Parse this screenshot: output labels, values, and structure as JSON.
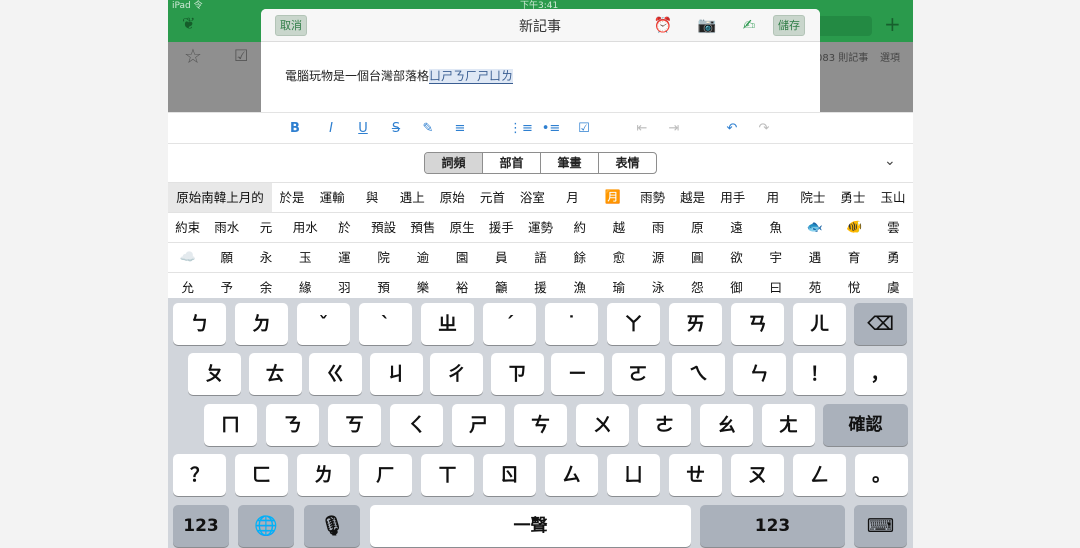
{
  "status_bar": {
    "carrier": "iPad 令",
    "time": "下午3:41"
  },
  "app_bg": {
    "count_label": "083 則記事",
    "options_label": "選項"
  },
  "editor": {
    "cancel_label": "取消",
    "title": "新記事",
    "save_label": "儲存",
    "note_text": "電腦玩物是一個台灣部落格",
    "composing_text": "ㄩㄕㄋㄏㄕㄩㄌ"
  },
  "toolbar": {
    "icons": [
      "bold-icon",
      "italic-icon",
      "underline-icon",
      "strikethrough-icon",
      "highlight-icon",
      "align-icon",
      "numbered-list-icon",
      "bullet-list-icon",
      "checkbox-icon",
      "outdent-icon",
      "indent-icon",
      "undo-icon",
      "redo-icon"
    ],
    "glyphs": [
      "B",
      "I",
      "U",
      "S",
      "✎",
      "≡",
      "⋮≡",
      "•≡",
      "☑",
      "⇤",
      "⇥",
      "↶",
      "↷"
    ]
  },
  "candidate_tabs": [
    {
      "label": "詞頻",
      "active": true
    },
    {
      "label": "部首",
      "active": false
    },
    {
      "label": "筆畫",
      "active": false
    },
    {
      "label": "表情",
      "active": false
    }
  ],
  "candidate_rows": [
    [
      "原始南韓上月的",
      "於是",
      "運輸",
      "與",
      "遇上",
      "原始",
      "元首",
      "浴室",
      "月",
      "🈷️",
      "雨勢",
      "越是",
      "用手",
      "用",
      "院士",
      "勇士",
      "玉山"
    ],
    [
      "約束",
      "雨水",
      "元",
      "用水",
      "於",
      "預設",
      "預售",
      "原生",
      "援手",
      "運勢",
      "約",
      "越",
      "雨",
      "原",
      "遠",
      "魚",
      "🐟",
      "🐠",
      "雲"
    ],
    [
      "☁️",
      "願",
      "永",
      "玉",
      "運",
      "院",
      "逾",
      "園",
      "員",
      "語",
      "餘",
      "愈",
      "源",
      "圓",
      "欲",
      "宇",
      "遇",
      "育",
      "勇"
    ],
    [
      "允",
      "予",
      "余",
      "緣",
      "羽",
      "預",
      "樂",
      "裕",
      "籲",
      "援",
      "漁",
      "瑜",
      "泳",
      "怨",
      "御",
      "曰",
      "苑",
      "悅",
      "虞"
    ]
  ],
  "keyboard": {
    "row1": [
      "ㄅ",
      "ㄉ",
      "ˇ",
      "ˋ",
      "ㄓ",
      "ˊ",
      "˙",
      "ㄚ",
      "ㄞ",
      "ㄢ",
      "ㄦ"
    ],
    "row2": [
      "ㄆ",
      "ㄊ",
      "ㄍ",
      "ㄐ",
      "ㄔ",
      "ㄗ",
      "ㄧ",
      "ㄛ",
      "ㄟ",
      "ㄣ",
      "！",
      "，"
    ],
    "row3": [
      "ㄇ",
      "ㄋ",
      "ㄎ",
      "ㄑ",
      "ㄕ",
      "ㄘ",
      "ㄨ",
      "ㄜ",
      "ㄠ",
      "ㄤ"
    ],
    "row4": [
      "？",
      "ㄈ",
      "ㄌ",
      "ㄏ",
      "ㄒ",
      "ㄖ",
      "ㄙ",
      "ㄩ",
      "ㄝ",
      "ㄡ",
      "ㄥ",
      "。"
    ],
    "confirm_label": "確認",
    "numbers_label": "123",
    "space_label": "一聲"
  }
}
